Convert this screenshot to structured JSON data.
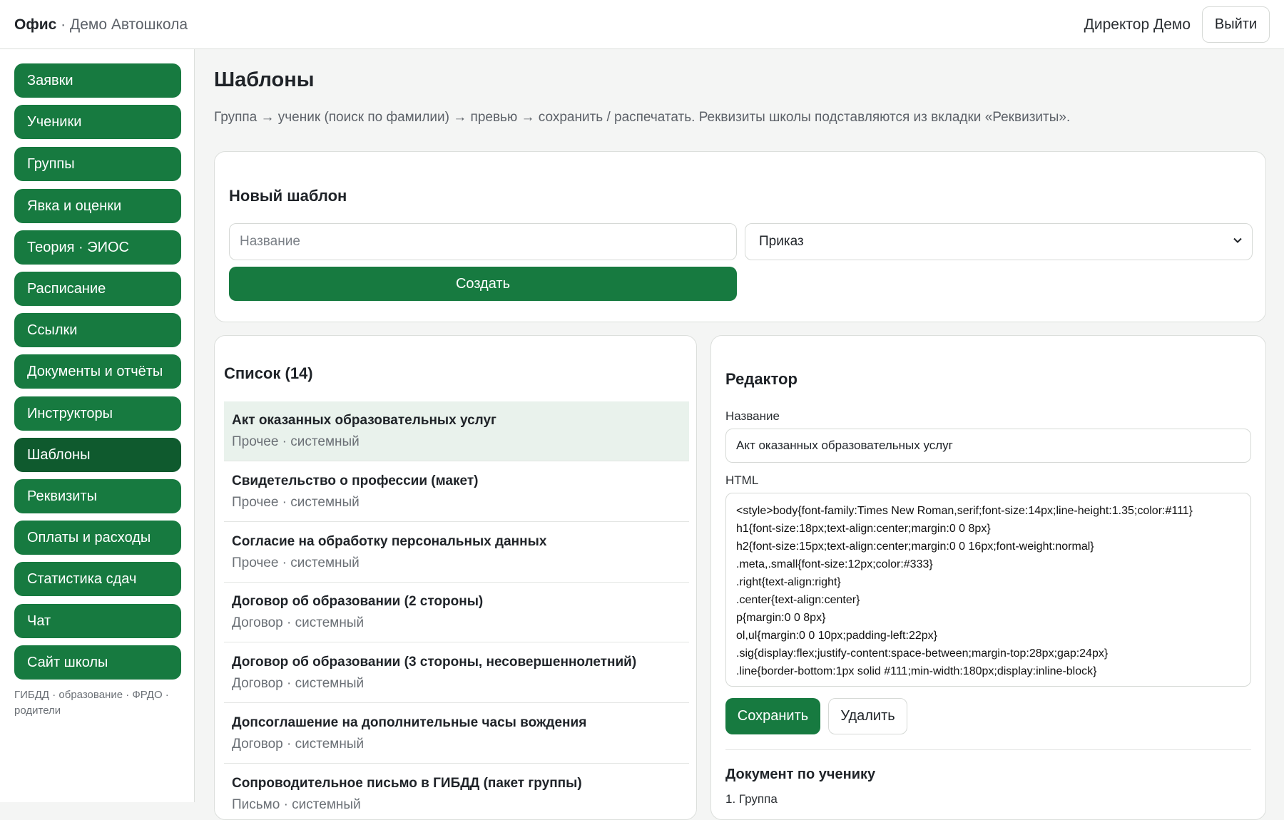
{
  "header": {
    "brand": "Офис",
    "brand_sep": " · ",
    "school": "Демо Автошкола",
    "user": "Директор Демо",
    "logout_label": "Выйти"
  },
  "sidebar": {
    "items": [
      {
        "label": "Заявки"
      },
      {
        "label": "Ученики"
      },
      {
        "label": "Группы"
      },
      {
        "label": "Явка и оценки"
      },
      {
        "label": "Теория · ЭИОС"
      },
      {
        "label": "Расписание"
      },
      {
        "label": "Ссылки"
      },
      {
        "label": "Документы и отчёты"
      },
      {
        "label": "Инструкторы"
      },
      {
        "label": "Шаблоны"
      },
      {
        "label": "Реквизиты"
      },
      {
        "label": "Оплаты и расходы"
      },
      {
        "label": "Статистика сдач"
      },
      {
        "label": "Чат"
      },
      {
        "label": "Сайт школы"
      }
    ],
    "active_label": "Шаблоны",
    "footer": "ГИБДД · образование · ФРДО · родители"
  },
  "main": {
    "title": "Шаблоны",
    "subtitle": "Группа → ученик (поиск по фамилии) → превью → сохранить / распечатать. Реквизиты школы подставляются из вкладки «Реквизиты»."
  },
  "new_template": {
    "heading": "Новый шаблон",
    "name_placeholder": "Название",
    "type_selected": "Приказ",
    "create_label": "Создать"
  },
  "list": {
    "heading": "Список (14)",
    "items": [
      {
        "title": "Акт оказанных образовательных услуг",
        "meta": "Прочее · системный"
      },
      {
        "title": "Свидетельство о профессии (макет)",
        "meta": "Прочее · системный"
      },
      {
        "title": "Согласие на обработку персональных данных",
        "meta": "Прочее · системный"
      },
      {
        "title": "Договор об образовании (2 стороны)",
        "meta": "Договор · системный"
      },
      {
        "title": "Договор об образовании (3 стороны, несовершеннолетний)",
        "meta": "Договор · системный"
      },
      {
        "title": "Допсоглашение на дополнительные часы вождения",
        "meta": "Договор · системный"
      },
      {
        "title": "Сопроводительное письмо в ГИБДД (пакет группы)",
        "meta": "Письмо · системный"
      }
    ]
  },
  "editor": {
    "heading": "Редактор",
    "name_label": "Название",
    "name_value": "Акт оказанных образовательных услуг",
    "html_label": "HTML",
    "html_value": "<style>body{font-family:Times New Roman,serif;font-size:14px;line-height:1.35;color:#111}\nh1{font-size:18px;text-align:center;margin:0 0 8px}\nh2{font-size:15px;text-align:center;margin:0 0 16px;font-weight:normal}\n.meta,.small{font-size:12px;color:#333}\n.right{text-align:right}\n.center{text-align:center}\np{margin:0 0 8px}\nol,ul{margin:0 0 10px;padding-left:22px}\n.sig{display:flex;justify-content:space-between;margin-top:28px;gap:24px}\n.line{border-bottom:1px solid #111;min-width:180px;display:inline-block}",
    "save_label": "Сохранить",
    "delete_label": "Удалить",
    "doc_heading": "Документ по ученику",
    "step1_label": "1. Группа"
  },
  "colors": {
    "accent": "#177a40",
    "accent_active": "#0f5a2e",
    "selected_row": "#e9f2ec"
  }
}
